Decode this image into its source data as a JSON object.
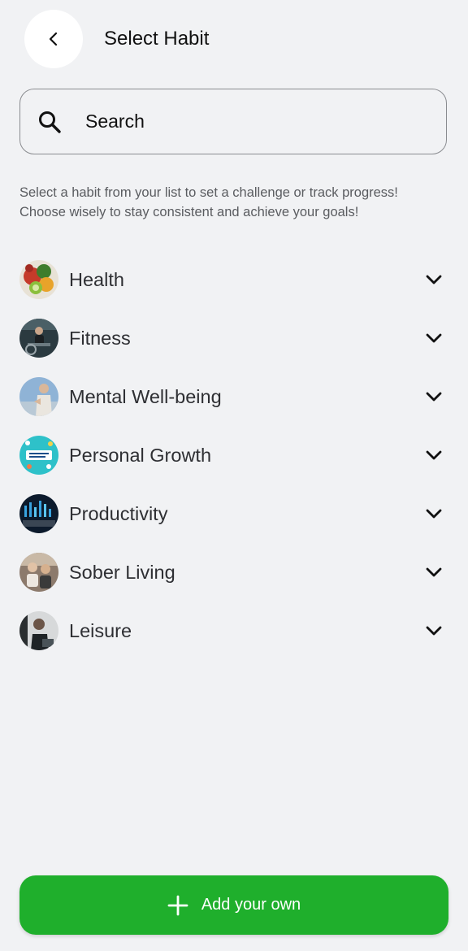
{
  "header": {
    "title": "Select Habit",
    "back_icon": "chevron-left-icon"
  },
  "search": {
    "placeholder": "Search",
    "value": "",
    "icon": "search-icon"
  },
  "description": {
    "line1": "Select a habit from your list to set a challenge or track progress!",
    "line2": "Choose wisely to stay consistent and achieve your goals!"
  },
  "categories": [
    {
      "label": "Health",
      "icon": "chevron-down-icon"
    },
    {
      "label": "Fitness",
      "icon": "chevron-down-icon"
    },
    {
      "label": "Mental Well-being",
      "icon": "chevron-down-icon"
    },
    {
      "label": "Personal Growth",
      "icon": "chevron-down-icon"
    },
    {
      "label": "Productivity",
      "icon": "chevron-down-icon"
    },
    {
      "label": "Sober Living",
      "icon": "chevron-down-icon"
    },
    {
      "label": "Leisure",
      "icon": "chevron-down-icon"
    }
  ],
  "footer": {
    "add_label": "Add your own",
    "add_icon": "plus-icon"
  },
  "colors": {
    "background": "#f1f2f4",
    "accent": "#1faf2c",
    "text": "#2e2f33"
  }
}
